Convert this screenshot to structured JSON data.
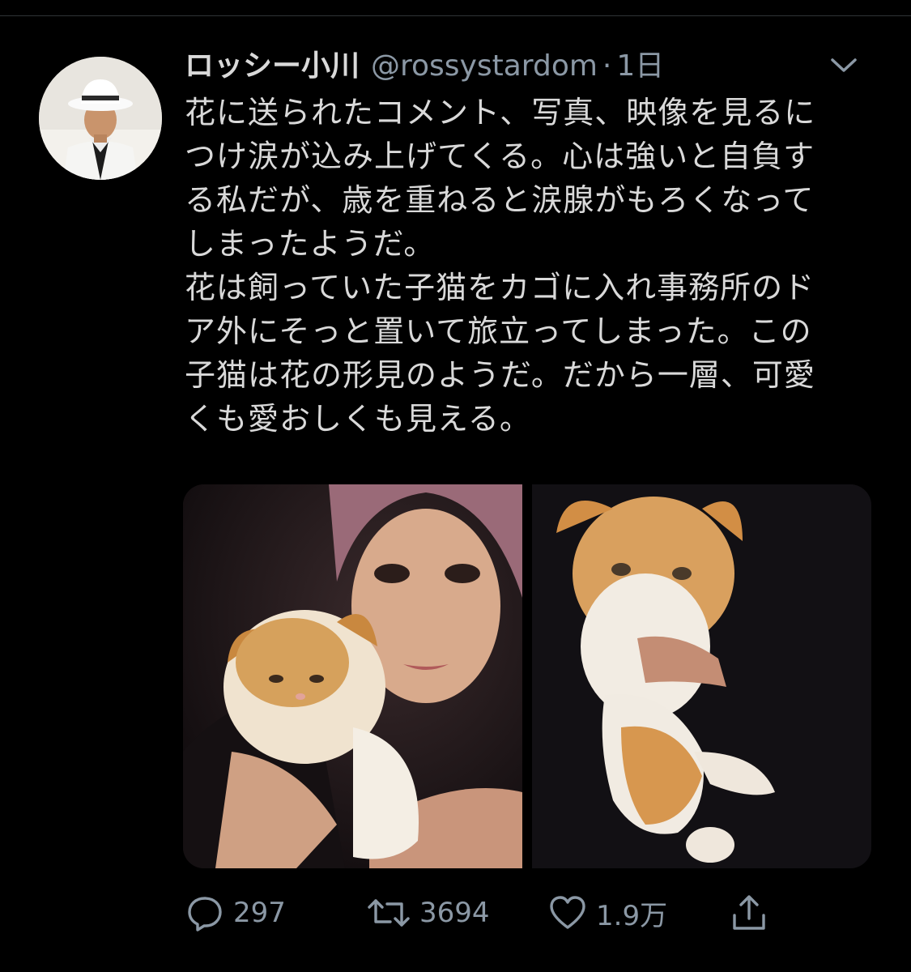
{
  "tweet": {
    "display_name": "ロッシー小川",
    "handle": "@rossystardom",
    "separator": "·",
    "time": "1日",
    "lines": [
      "花に送られたコメント、写真、映像を見るに",
      "つけ涙が込み上げてくる。心は強いと自負す",
      "る私だが、歳を重ねると涙腺がもろくなって",
      "しまったようだ。",
      "花は飼っていた子猫をカゴに入れ事務所のド",
      "ア外にそっと置いて旅立ってしまった。この",
      "子猫は花の形見のようだ。だから一層、可愛",
      "くも愛おしくも見える。"
    ]
  },
  "actions": {
    "reply_count": "297",
    "retweet_count": "3694",
    "like_count": "1.9万"
  },
  "icons": {
    "reply": "speech-bubble-icon",
    "retweet": "retweet-arrows-icon",
    "like": "heart-icon",
    "share": "share-upload-icon",
    "more": "chevron-down-icon"
  },
  "colors": {
    "background": "#000000",
    "text": "#d9d9d9",
    "secondary": "#8b98a5"
  }
}
